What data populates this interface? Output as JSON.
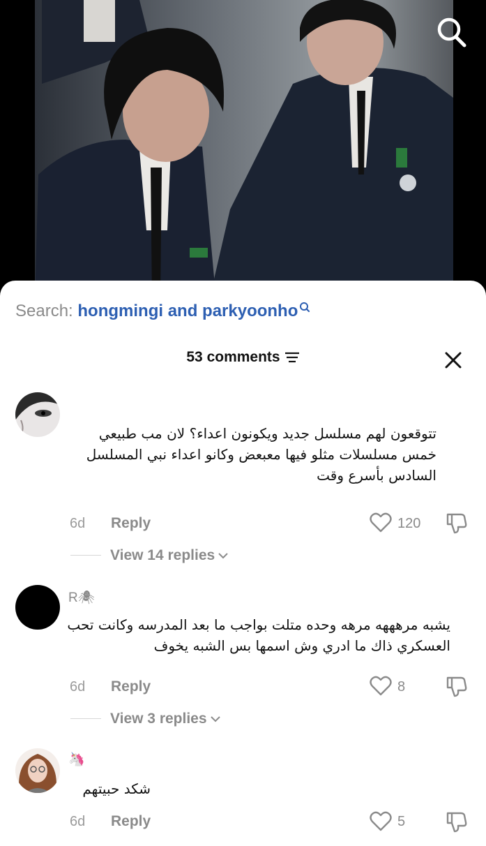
{
  "search": {
    "prefix": "Search:",
    "query": "hongmingi and parkyoonho"
  },
  "header": {
    "comments_count": "53 comments"
  },
  "comments": [
    {
      "username": "",
      "text": "تتوقعون لهم مسلسل جديد ويكونون اعداء؟ لان مب طبيعي خمس مسلسلات مثلو فيها معبعض وكانو اعداء نبي المسلسل السادس بأسرع وقت",
      "age": "6d",
      "reply_label": "Reply",
      "likes": "120",
      "view_replies": "View 14 replies"
    },
    {
      "username": "R🕷",
      "text": "يشبه مرهههه مرهه وحده متلت بواجب ما بعد المدرسه وكانت تحب العسكري ذاك ما ادري وش اسمها بس الشبه يخوف",
      "age": "6d",
      "reply_label": "Reply",
      "likes": "8",
      "view_replies": "View 3 replies"
    },
    {
      "username": "🦄",
      "text": "شكد حبيتهم",
      "age": "6d",
      "reply_label": "Reply",
      "likes": "5"
    }
  ],
  "colors": {
    "link": "#2d5fb2",
    "muted": "#8a8a8a",
    "sheet": "#ffffff"
  }
}
